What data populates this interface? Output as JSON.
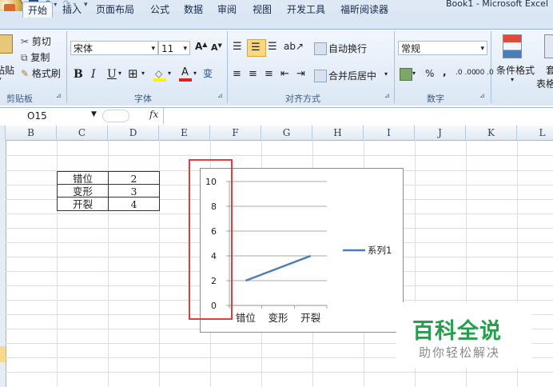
{
  "window": {
    "title": "Book1 - Microsoft Excel"
  },
  "quick_access": {
    "save_icon": "save-icon",
    "undo": "↶",
    "redo": "↷"
  },
  "tabs": [
    "开始",
    "插入",
    "页面布局",
    "公式",
    "数据",
    "审阅",
    "视图",
    "开发工具",
    "福昕阅读器"
  ],
  "ribbon": {
    "clipboard": {
      "paste": "粘贴",
      "cut": "剪切",
      "copy": "复制",
      "format_painter": "格式刷",
      "label": "剪贴板"
    },
    "font": {
      "name": "宋体",
      "size": "11",
      "grow": "A",
      "shrink": "A",
      "bold": "B",
      "italic": "I",
      "underline": "U",
      "wen": "变",
      "label": "字体"
    },
    "alignment": {
      "wrap": "自动换行",
      "merge": "合并后居中",
      "label": "对齐方式"
    },
    "number": {
      "format": "常规",
      "percent": "%",
      "comma": ",",
      "inc": ".0 .00",
      "dec": ".00 .0",
      "label": "数字"
    },
    "styles": {
      "cond_format": "条件格式",
      "table_format": "套用",
      "table_format2": "表格"
    }
  },
  "formula_bar": {
    "name_box": "O15",
    "fx": "fx",
    "content": ""
  },
  "columns": [
    "B",
    "C",
    "D",
    "E",
    "F",
    "G",
    "H",
    "I",
    "J",
    "K",
    "L"
  ],
  "table": [
    {
      "label": "错位",
      "value": "2"
    },
    {
      "label": "变形",
      "value": "3"
    },
    {
      "label": "开裂",
      "value": "4"
    }
  ],
  "chart_data": {
    "type": "line",
    "categories": [
      "错位",
      "变形",
      "开裂"
    ],
    "series": [
      {
        "name": "系列1",
        "values": [
          2,
          3,
          4
        ]
      }
    ],
    "ylim": [
      0,
      10
    ],
    "yticks": [
      "0",
      "2",
      "4",
      "6",
      "8",
      "10"
    ],
    "title": "",
    "xlabel": "",
    "ylabel": "",
    "grid": true,
    "legend": "right",
    "line_color": "#4a7ebb"
  },
  "watermark": {
    "title": "百科全说",
    "subtitle": "助你轻松解决"
  }
}
